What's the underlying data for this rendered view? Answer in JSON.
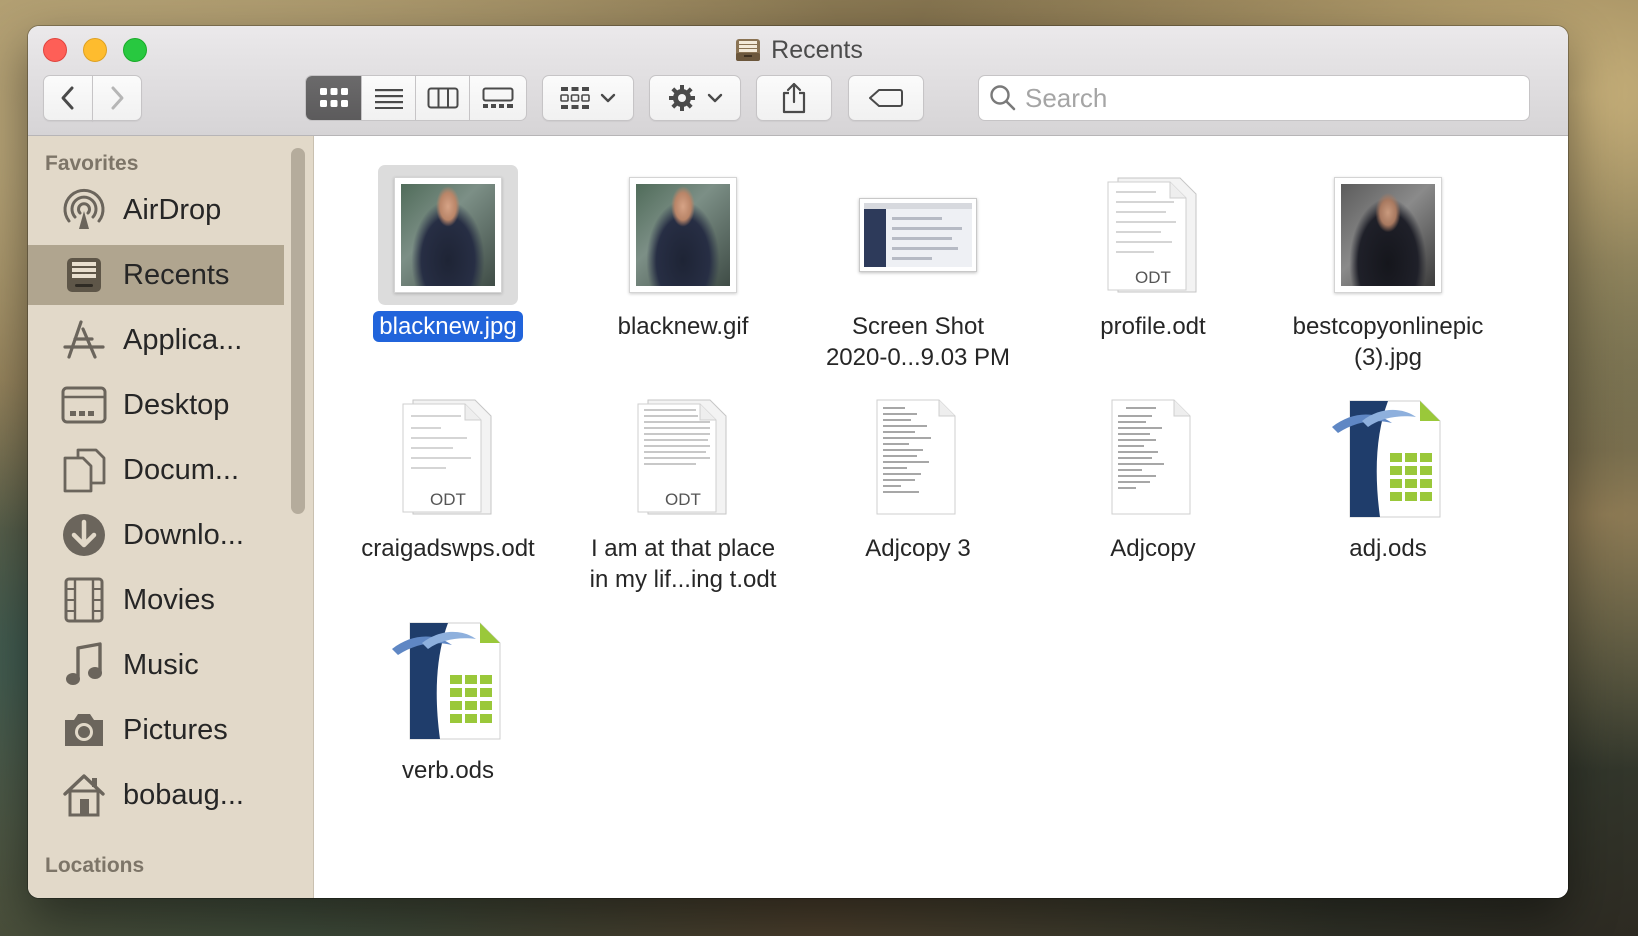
{
  "window": {
    "title": "Recents"
  },
  "toolbar": {
    "search_placeholder": "Search"
  },
  "sidebar": {
    "favorites_heading": "Favorites",
    "locations_heading": "Locations",
    "items": [
      {
        "label": "AirDrop",
        "icon": "airdrop-icon"
      },
      {
        "label": "Recents",
        "icon": "recents-icon",
        "selected": true
      },
      {
        "label": "Applica...",
        "icon": "applications-icon"
      },
      {
        "label": "Desktop",
        "icon": "desktop-icon"
      },
      {
        "label": "Docum...",
        "icon": "documents-icon"
      },
      {
        "label": "Downlo...",
        "icon": "downloads-icon"
      },
      {
        "label": "Movies",
        "icon": "movies-icon"
      },
      {
        "label": "Music",
        "icon": "music-icon"
      },
      {
        "label": "Pictures",
        "icon": "pictures-icon"
      },
      {
        "label": "bobaug...",
        "icon": "home-icon"
      }
    ]
  },
  "files": [
    {
      "name": "blacknew.jpg",
      "type": "photo",
      "selected": true
    },
    {
      "name": "blacknew.gif",
      "type": "photo"
    },
    {
      "name": "Screen Shot\n2020-0...9.03 PM",
      "type": "screenshot"
    },
    {
      "name": "profile.odt",
      "type": "odt",
      "badge": "ODT"
    },
    {
      "name": "bestcopyonlinepic\n(3).jpg",
      "type": "photo-alt"
    },
    {
      "name": "craigadswps.odt",
      "type": "odt",
      "badge": "ODT"
    },
    {
      "name": "I am at that place\nin my lif...ing t.odt",
      "type": "odt",
      "badge": "ODT"
    },
    {
      "name": "Adjcopy 3",
      "type": "text"
    },
    {
      "name": "Adjcopy",
      "type": "text"
    },
    {
      "name": "adj.ods",
      "type": "ods"
    },
    {
      "name": "verb.ods",
      "type": "ods"
    }
  ],
  "colors": {
    "selection": "#2164db",
    "sidebar_bg": "#e2d9c9",
    "sidebar_selected": "#b0a58f"
  }
}
